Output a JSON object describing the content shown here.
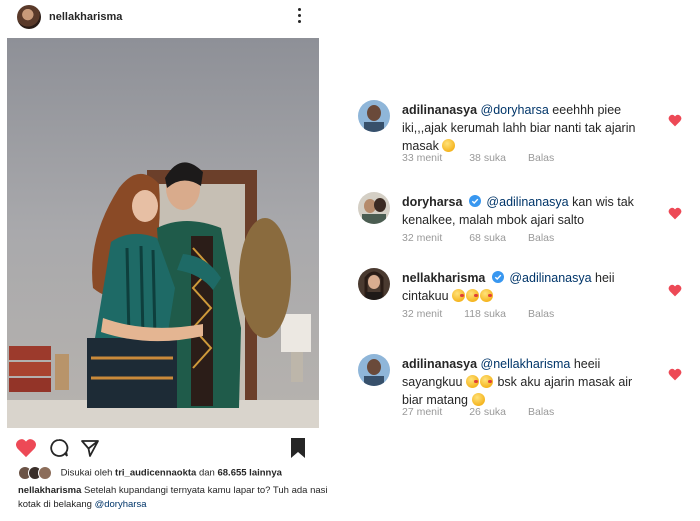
{
  "post": {
    "username": "nellakharisma",
    "liked_by_prefix": "Disukai oleh",
    "liked_by_user": "tri_audicennaokta",
    "liked_by_and": "dan",
    "liked_by_count": "68.655 lainnya",
    "caption_username": "nellakharisma",
    "caption_text": "Setelah kupandangi ternyata kamu lapar to? Tuh ada nasi kotak di belakang",
    "caption_mention": "@doryharsa",
    "liked": true
  },
  "comments": [
    {
      "username": "adilinanasya",
      "verified": false,
      "mention": "@doryharsa",
      "text": "eeehhh piee iki,,,ajak kerumah lahh biar nanti tak ajarin masak",
      "emoji": "grimace-emoji",
      "time": "33 menit",
      "likes": "38 suka",
      "reply": "Balas"
    },
    {
      "username": "doryharsa",
      "verified": true,
      "mention": "@adilinanasya",
      "text": "kan wis tak kenalkee, malah mbok ajari salto",
      "time": "32 menit",
      "likes": "68 suka",
      "reply": "Balas"
    },
    {
      "username": "nellakharisma",
      "verified": true,
      "mention": "@adilinanasya",
      "text": "heii cintakuu",
      "emoji": "kiss-emoji",
      "time": "32 menit",
      "likes": "118 suka",
      "reply": "Balas"
    },
    {
      "username": "adilinanasya",
      "verified": false,
      "mention": "@nellakharisma",
      "text_part1": "heeii sayangkuu",
      "text_part2": "bsk aku ajarin masak air biar matang",
      "time": "27 menit",
      "likes": "26 suka",
      "reply": "Balas"
    }
  ],
  "colors": {
    "heart_red": "#ed4956",
    "verified_blue": "#3897f0",
    "meta_gray": "#999999",
    "mention_blue": "#003569"
  }
}
